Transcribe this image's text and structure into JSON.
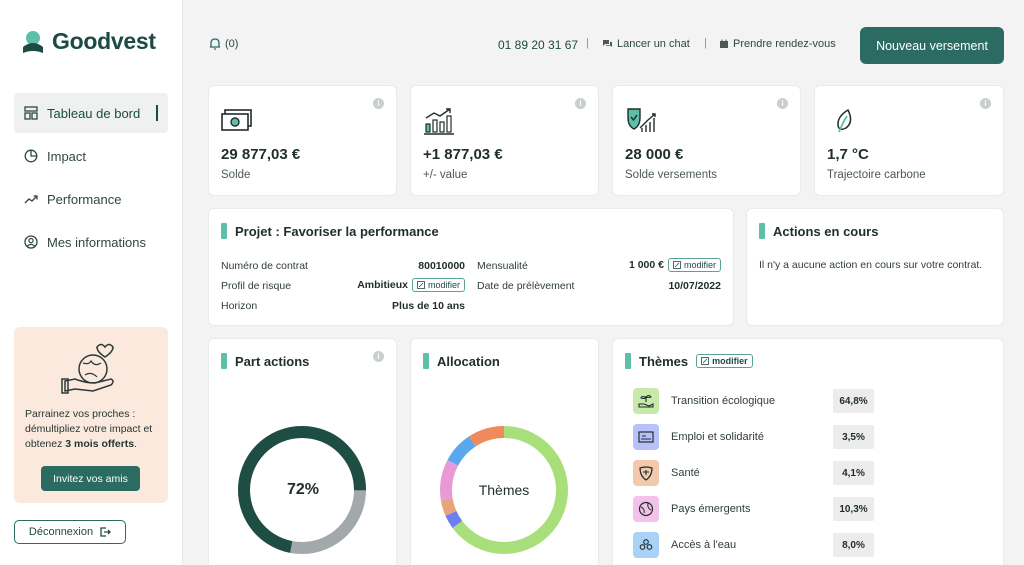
{
  "brand": {
    "name": "Goodvest",
    "color": "#1d4a44",
    "accent": "#2b6b62",
    "highlight": "#5dbfa8"
  },
  "sidebar": {
    "items": [
      {
        "label": "Tableau de bord",
        "icon": "dashboard-icon",
        "active": true
      },
      {
        "label": "Impact",
        "icon": "pie-icon",
        "active": false
      },
      {
        "label": "Performance",
        "icon": "trend-icon",
        "active": false
      },
      {
        "label": "Mes informations",
        "icon": "user-icon",
        "active": false
      }
    ],
    "promo": {
      "text_before": "Parrainez vos proches : démultipliez votre impact et obtenez ",
      "text_bold": "3 mois offerts",
      "text_after": ".",
      "button": "Invitez vos amis"
    },
    "logout": "Déconnexion"
  },
  "header": {
    "notifications": "(0)",
    "phone": "01 89 20 31 67",
    "separator": "|",
    "chat": "Lancer un chat",
    "appointment": "Prendre rendez-vous",
    "cta": "Nouveau versement"
  },
  "stats": [
    {
      "value": "29 877,03 €",
      "label": "Solde",
      "icon": "cash-icon"
    },
    {
      "value": "+1 877,03 €",
      "label": "+/- value",
      "icon": "bar-growth-icon"
    },
    {
      "value": "28 000 €",
      "label": "Solde versements",
      "icon": "shield-growth-icon"
    },
    {
      "value": "1,7 °C",
      "label": "Trajectoire carbone",
      "icon": "leaf-icon"
    }
  ],
  "project": {
    "title": "Projet : Favoriser la performance",
    "contract_label": "Numéro de contrat",
    "contract_value": "80010000",
    "risk_label": "Profil de risque",
    "risk_value": "Ambitieux",
    "horizon_label": "Horizon",
    "horizon_value": "Plus de 10 ans",
    "monthly_label": "Mensualité",
    "monthly_value": "1 000 €",
    "debit_label": "Date de prélèvement",
    "debit_value": "10/07/2022",
    "modify": "modifier"
  },
  "actions": {
    "title": "Actions en cours",
    "text": "Il n'y a aucune action en cours sur votre contrat."
  },
  "part_actions": {
    "title": "Part actions",
    "center": "72%",
    "value": 0.72,
    "colors": {
      "main": "#1e4d44",
      "rest": "#a3a8ab"
    }
  },
  "allocation": {
    "title": "Allocation",
    "center": "Thèmes",
    "segments": [
      {
        "value": 64.8,
        "color": "#a8df7a"
      },
      {
        "value": 3.5,
        "color": "#6b7ff0"
      },
      {
        "value": 4.1,
        "color": "#e8a57d"
      },
      {
        "value": 10.3,
        "color": "#e89ad6"
      },
      {
        "value": 8.0,
        "color": "#58a8ee"
      },
      {
        "value": 9.3,
        "color": "#f08a5d"
      }
    ]
  },
  "themes": {
    "title": "Thèmes",
    "modify": "modifier",
    "items": [
      {
        "label": "Transition écologique",
        "pct": "64,8%",
        "icon": "plant-hand-icon",
        "bg": "#c7e9a9"
      },
      {
        "label": "Emploi et solidarité",
        "pct": "3,5%",
        "icon": "solidarity-icon",
        "bg": "#b9c2f8"
      },
      {
        "label": "Santé",
        "pct": "4,1%",
        "icon": "health-icon",
        "bg": "#f3c9ad"
      },
      {
        "label": "Pays émergents",
        "pct": "10,3%",
        "icon": "globe-icon",
        "bg": "#f2c2ea"
      },
      {
        "label": "Accès à l'eau",
        "pct": "8,0%",
        "icon": "water-icon",
        "bg": "#a9d2f6"
      }
    ]
  }
}
